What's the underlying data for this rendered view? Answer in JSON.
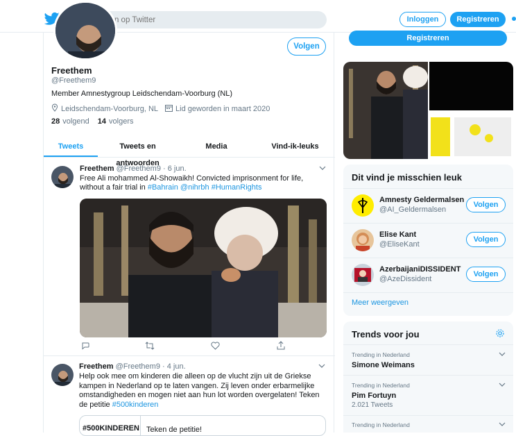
{
  "header": {
    "search_placeholder": "Zoeken op Twitter",
    "login_label": "Inloggen",
    "register_label": "Registreren"
  },
  "profile": {
    "follow_label": "Volgen",
    "name": "Freethem",
    "handle": "@Freethem9",
    "bio": "Member Amnestygroup Leidschendam-Voorburg (NL)",
    "location": "Leidschendam-Voorburg, NL",
    "joined": "Lid geworden in maart 2020",
    "following_count": "28",
    "following_label": "volgend",
    "followers_count": "14",
    "followers_label": "volgers"
  },
  "tabs": [
    {
      "label": "Tweets",
      "active": true
    },
    {
      "label": "Tweets en antwoorden",
      "active": false
    },
    {
      "label": "Media",
      "active": false
    },
    {
      "label": "Vind-ik-leuks",
      "active": false
    }
  ],
  "tweets": [
    {
      "name": "Freethem",
      "meta": "@Freethem9 · 6 jun.",
      "text_plain": "Free Ali mohammed Al-Showaikh! Convicted imprisonment for life, without a fair trial in ",
      "text_links": "#Bahrain @nihrbh #HumanRights"
    },
    {
      "name": "Freethem",
      "meta": "@Freethem9 · 4 jun.",
      "text_plain": "Help ook mee om kinderen die alleen op de vlucht zijn uit de Griekse kampen in Nederland op te laten vangen. Zij leven onder erbarmelijke omstandigheden en mogen niet aan hun lot worden overgelaten! Teken de petitie ",
      "text_links": "#500kinderen",
      "card_logo": "#500KINDEREN",
      "card_text": "Teken de petitie!"
    }
  ],
  "right": {
    "register_label": "Registreren",
    "suggest_title": "Dit vind je misschien leuk",
    "suggestions": [
      {
        "name": "Amnesty Geldermalsen",
        "handle": "@AI_Geldermalsen",
        "button": "Volgen"
      },
      {
        "name": "Elise Kant",
        "handle": "@EliseKant",
        "button": "Volgen"
      },
      {
        "name": "AzerbaijaniDISSIDENT",
        "handle": "@AzeDissident",
        "button": "Volgen"
      }
    ],
    "show_more": "Meer weergeven",
    "trends_title": "Trends voor jou",
    "trends": [
      {
        "context": "Trending in Nederland",
        "name": "Simone Weimans",
        "count": ""
      },
      {
        "context": "Trending in Nederland",
        "name": "Pim Fortuyn",
        "count": "2.021 Tweets"
      },
      {
        "context": "Trending in Nederland",
        "name": "",
        "count": ""
      }
    ]
  },
  "colors": {
    "accent": "#1da1f2",
    "link": "#1b95e0",
    "muted": "#657786",
    "border": "#e6ecf0"
  }
}
